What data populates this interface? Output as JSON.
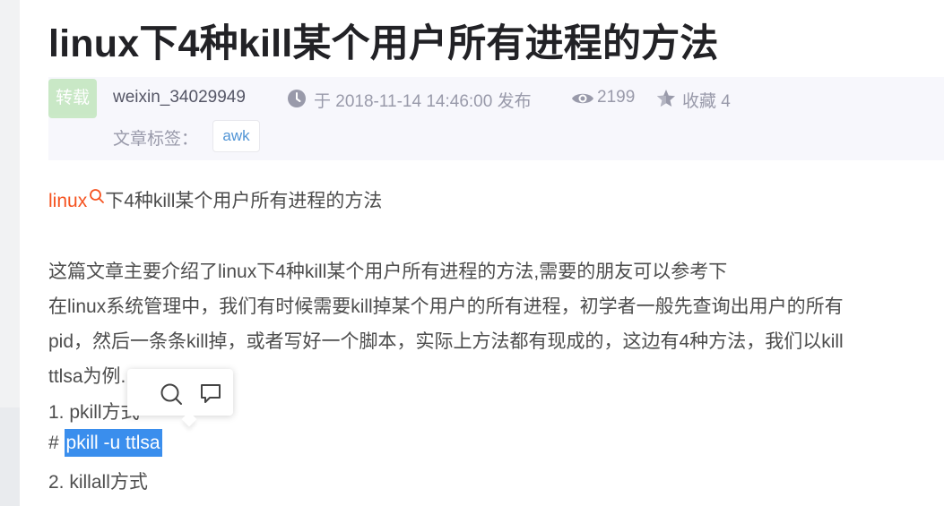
{
  "title": "linux下4种kill某个用户所有进程的方法",
  "meta": {
    "badge": "转载",
    "author": "weixin_34029949",
    "published": "于 2018-11-14 14:46:00 发布",
    "views": "2199",
    "favorites": "收藏 4",
    "tags_label": "文章标签：",
    "tags": [
      "awk"
    ]
  },
  "content": {
    "keyword_link": "linux",
    "heading_rest": "下4种kill某个用户所有进程的方法",
    "lines": [
      "这篇文章主要介绍了linux下4种kill某个用户所有进程的方法,需要的朋友可以参考下",
      "在linux系统管理中，我们有时候需要kill掉某个用户的所有进程，初学者一般先查询出用户的所有",
      "pid，然后一条条kill掉，或者写好一个脚本，实际上方法都有现成的，这边有4种方法，我们以kill",
      "ttlsa为例.",
      "1. pkill方式",
      "# ",
      "pkill -u ttlsa",
      "2. killall方式"
    ]
  },
  "colors": {
    "accent_keyword": "#f5521f",
    "selection": "#3a8eed",
    "tag_text": "#5094d5",
    "badge_bg": "#c7e8c4"
  },
  "icons": {
    "time": "clock-icon",
    "views": "eye-icon",
    "favorite": "star-icon",
    "keyword_search": "search-icon",
    "popup_search": "search-icon",
    "popup_comment": "comment-icon"
  }
}
